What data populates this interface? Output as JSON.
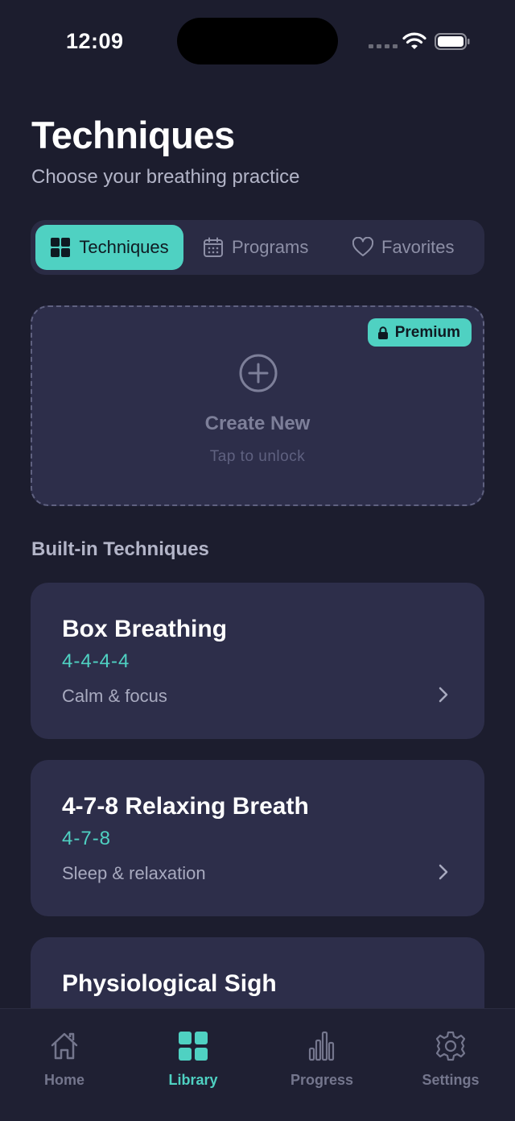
{
  "status_bar": {
    "time": "12:09"
  },
  "header": {
    "title": "Techniques",
    "subtitle": "Choose your breathing practice"
  },
  "segments": [
    {
      "label": "Techniques",
      "icon": "grid-icon",
      "active": true
    },
    {
      "label": "Programs",
      "icon": "calendar-icon",
      "active": false
    },
    {
      "label": "Favorites",
      "icon": "heart-icon",
      "active": false
    }
  ],
  "create_card": {
    "badge": "Premium",
    "title": "Create New",
    "subtitle": "Tap to unlock"
  },
  "section_title": "Built-in Techniques",
  "techniques": [
    {
      "name": "Box Breathing",
      "pattern": "4-4-4-4",
      "description": "Calm & focus"
    },
    {
      "name": "4-7-8 Relaxing Breath",
      "pattern": "4-7-8",
      "description": "Sleep & relaxation"
    },
    {
      "name": "Physiological Sigh"
    }
  ],
  "tab_bar": [
    {
      "label": "Home",
      "icon": "home-icon",
      "active": false
    },
    {
      "label": "Library",
      "icon": "library-grid-icon",
      "active": true
    },
    {
      "label": "Progress",
      "icon": "bar-chart-icon",
      "active": false
    },
    {
      "label": "Settings",
      "icon": "gear-icon",
      "active": false
    }
  ],
  "colors": {
    "background": "#1c1d2e",
    "card": "#2d2e4a",
    "accent": "#4fd1c2",
    "muted_text": "#b3b5c8"
  }
}
